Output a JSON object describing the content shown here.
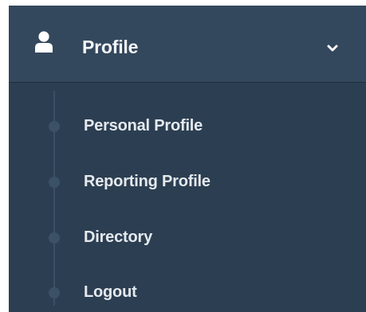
{
  "menu": {
    "icon": "user-icon",
    "title": "Profile",
    "toggle_icon": "chevron-down-icon",
    "items": [
      {
        "label": "Personal Profile"
      },
      {
        "label": "Reporting Profile"
      },
      {
        "label": "Directory"
      },
      {
        "label": "Logout"
      }
    ]
  },
  "colors": {
    "header_background": "#34485d",
    "submenu_background": "#2c3e51",
    "text": "#e4e9ee",
    "tree_line": "#3b5166"
  }
}
